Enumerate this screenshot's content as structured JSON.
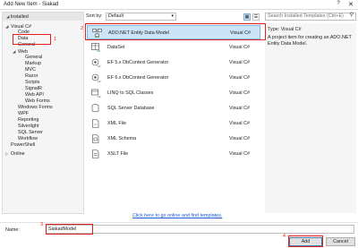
{
  "window": {
    "title": "Add New Item - Siakad",
    "help": "?",
    "close": "✕"
  },
  "left": {
    "installed_label": "Installed",
    "tree": [
      {
        "label": "Visual C#",
        "arrow": "◢"
      },
      {
        "label": "Code",
        "arrow": ""
      },
      {
        "label": "Data",
        "arrow": ""
      },
      {
        "label": "General",
        "arrow": ""
      },
      {
        "label": "Web",
        "arrow": "◢"
      },
      {
        "label": "General",
        "arrow": ""
      },
      {
        "label": "Markup",
        "arrow": ""
      },
      {
        "label": "MVC",
        "arrow": ""
      },
      {
        "label": "Razor",
        "arrow": ""
      },
      {
        "label": "Scripts",
        "arrow": ""
      },
      {
        "label": "SignalR",
        "arrow": ""
      },
      {
        "label": "Web API",
        "arrow": ""
      },
      {
        "label": "Web Forms",
        "arrow": ""
      },
      {
        "label": "Windows Forms",
        "arrow": ""
      },
      {
        "label": "WPF",
        "arrow": ""
      },
      {
        "label": "Reporting",
        "arrow": ""
      },
      {
        "label": "Silverlight",
        "arrow": ""
      },
      {
        "label": "SQL Server",
        "arrow": ""
      },
      {
        "label": "Workflow",
        "arrow": ""
      },
      {
        "label": "PowerShell",
        "arrow": ""
      }
    ],
    "online_label": "Online",
    "online_arrow": "▷"
  },
  "toolbar": {
    "sort_label": "Sort by:",
    "sort_value": "Default",
    "caret": "▾",
    "view_icons": [
      "▦",
      "☰"
    ]
  },
  "search": {
    "placeholder": "Search Installed Templates (Ctrl+E)",
    "icon": "⚲"
  },
  "templates": [
    {
      "name": "ADO.NET Entity Data Model",
      "lang": "Visual C#"
    },
    {
      "name": "DataSet",
      "lang": "Visual C#"
    },
    {
      "name": "EF 5.x DbContext Generator",
      "lang": "Visual C#"
    },
    {
      "name": "EF 6.x DbContext Generator",
      "lang": "Visual C#"
    },
    {
      "name": "LINQ to SQL Classes",
      "lang": "Visual C#"
    },
    {
      "name": "SQL Server Database",
      "lang": "Visual C#"
    },
    {
      "name": "XML File",
      "lang": "Visual C#"
    },
    {
      "name": "XML Schema",
      "lang": "Visual C#"
    },
    {
      "name": "XSLT File",
      "lang": "Visual C#"
    }
  ],
  "details": {
    "type_label": "Type:",
    "type_value": "Visual C#",
    "description": "A project item for creating an ADO.NET Entity Data Model."
  },
  "online_link": "Click here to go online and find templates.",
  "name_field": {
    "label": "Name:",
    "value": "SiakadModel"
  },
  "buttons": {
    "add": "Add",
    "cancel": "Cancel"
  },
  "annotations": [
    "1",
    "2",
    "3",
    "4"
  ],
  "colors": {
    "highlight": "#e01f1f",
    "selection": "#cce4f7",
    "link": "#1a5ad7"
  }
}
